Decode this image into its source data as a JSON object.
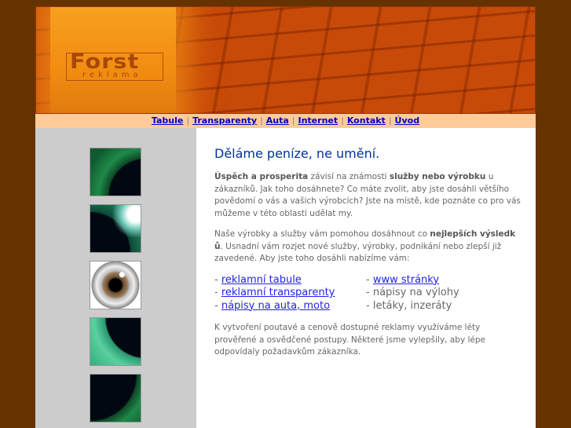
{
  "logo": {
    "name": "Forst",
    "tagline": "reklama"
  },
  "nav": [
    {
      "label": "Tabule"
    },
    {
      "label": "Transparenty"
    },
    {
      "label": "Auta"
    },
    {
      "label": " Internet"
    },
    {
      "label": "Kontakt"
    },
    {
      "label": "Úvod"
    }
  ],
  "nav_separator": "|",
  "sidebar_images": [
    "green-iris-icon",
    "green-iris-highlight-icon",
    "eyeball-icon",
    "light-green-iris-icon",
    "dark-green-iris-icon"
  ],
  "main": {
    "title": "Děláme peníze, ne umění.",
    "p1": {
      "b1": "Úspěch a prosperita",
      "t1": " závisí na známosti ",
      "b2": "služby nebo výrobku",
      "t2": " u zákazníků. Jak toho dosáhnete? Co máte zvolit, aby jste dosáhli většího povědomí o vás a vašich výrobcích? Jste na místě, kde poznáte co pro vás můžeme v této oblasti udělat my."
    },
    "p2": {
      "t1": "Naše výrobky a služby vám pomohou dosáhnout co ",
      "b1": "nejlepších výsledk ů",
      "t2": ". Usnadní vám rozjet nové služby, výrobky, podnikání nebo zlepší již zavedené. Aby jste toho dosáhli nabízíme vám:"
    },
    "list_left": [
      "reklamní tabule",
      "reklamní transparenty",
      "nápisy na auta, moto"
    ],
    "list_right": [
      {
        "text": "www stránky",
        "link": true
      },
      {
        "text": "nápisy na výlohy"
      },
      {
        "text": "letáky, inzeráty"
      }
    ],
    "dash": "- ",
    "p3": "K vytvoření poutavé a cenově dostupné reklamy využíváme léty prověřené a osvědčené postupy. Některé jsme vylepšily, aby lépe odpovídaly požadavkům zákazníka."
  },
  "colors": {
    "background": "#663300",
    "nav": "#ffcc99",
    "sidebar": "#cccccc",
    "title": "#003399"
  }
}
